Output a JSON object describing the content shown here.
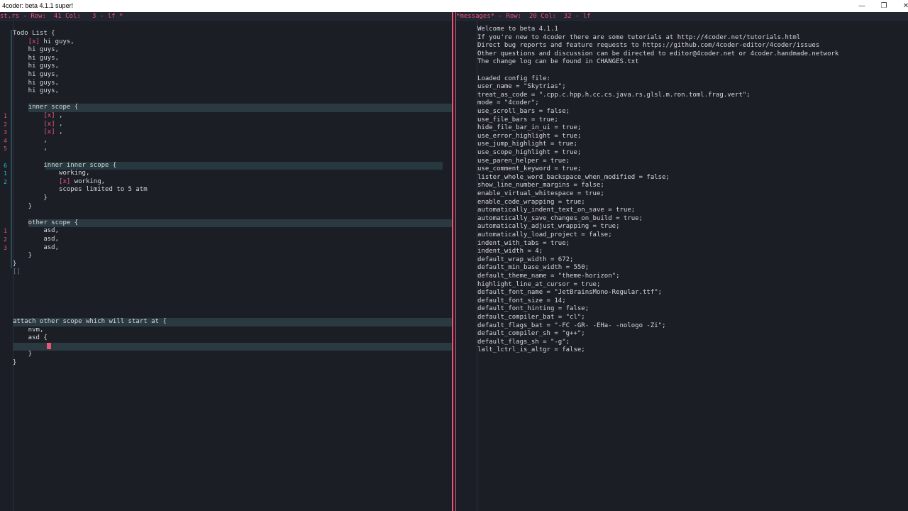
{
  "window": {
    "title": "4coder: beta 4.1.1 super!",
    "min": "—",
    "max": "❐",
    "close": "✕"
  },
  "left_pane": {
    "filebar": "st.rs - Row:  41 Col:   3 - lf *",
    "lines": [
      {
        "ln": "",
        "text": "Todo List {"
      },
      {
        "ln": "",
        "pre": "    ",
        "check": "[x]",
        "text": " hi guys,"
      },
      {
        "ln": "",
        "text": "    hi guys,"
      },
      {
        "ln": "",
        "text": "    hi guys,"
      },
      {
        "ln": "",
        "text": "    hi guys,"
      },
      {
        "ln": "",
        "text": "    hi guys,"
      },
      {
        "ln": "",
        "text": "    hi guys,"
      },
      {
        "ln": "",
        "text": "    hi guys,"
      },
      {
        "ln": "",
        "text": ""
      },
      {
        "ln": "",
        "text": "    inner scope {"
      },
      {
        "ln": "1",
        "pre": "        ",
        "check": "[x]",
        "text": " ,"
      },
      {
        "ln": "2",
        "pre": "        ",
        "check": "[x]",
        "text": " ,"
      },
      {
        "ln": "3",
        "pre": "        ",
        "check": "[x]",
        "text": " ,"
      },
      {
        "ln": "4",
        "text": "        ,"
      },
      {
        "ln": "5",
        "text": "        ,"
      },
      {
        "ln": "",
        "text": ""
      },
      {
        "ln": "6",
        "text": "        inner inner scope {"
      },
      {
        "ln": "1",
        "text": "            working,"
      },
      {
        "ln": "2",
        "pre": "            ",
        "check": "[x]",
        "text": " working,"
      },
      {
        "ln": "",
        "text": "            scopes limited to 5 atm"
      },
      {
        "ln": "",
        "text": "        }"
      },
      {
        "ln": "",
        "text": "    }"
      },
      {
        "ln": "",
        "text": ""
      },
      {
        "ln": "",
        "text": "    other scope {"
      },
      {
        "ln": "1",
        "text": "        asd,"
      },
      {
        "ln": "2",
        "text": "        asd,"
      },
      {
        "ln": "3",
        "text": "        asd,"
      },
      {
        "ln": "",
        "text": "    }"
      },
      {
        "ln": "",
        "text": "}"
      },
      {
        "ln": "",
        "text": "[]"
      },
      {
        "ln": "",
        "text": ""
      },
      {
        "ln": "",
        "text": ""
      },
      {
        "ln": "",
        "text": ""
      },
      {
        "ln": "",
        "text": ""
      },
      {
        "ln": "",
        "text": ""
      },
      {
        "ln": "",
        "text": "attach other scope which will start at {"
      },
      {
        "ln": "",
        "text": "    nvm,"
      },
      {
        "ln": "",
        "text": "    asd {"
      },
      {
        "ln": "",
        "text": ""
      },
      {
        "ln": "",
        "text": "    }"
      },
      {
        "ln": "",
        "text": "}"
      }
    ]
  },
  "right_pane": {
    "filebar": "*messages* - Row:  20 Col:  32 - lf",
    "lines": [
      "Welcome to beta 4.1.1",
      "If you're new to 4coder there are some tutorials at http://4coder.net/tutorials.html",
      "Direct bug reports and feature requests to https://github.com/4coder-editor/4coder/issues",
      "Other questions and discussion can be directed to editor@4coder.net or 4coder.handmade.network",
      "The change log can be found in CHANGES.txt",
      "",
      "Loaded config file:",
      "user_name = \"Skytrias\";",
      "treat_as_code = \".cpp.c.hpp.h.cc.cs.java.rs.glsl.m.ron.toml.frag.vert\";",
      "mode = \"4coder\";",
      "use_scroll_bars = false;",
      "use_file_bars = true;",
      "hide_file_bar_in_ui = true;",
      "use_error_highlight = true;",
      "use_jump_highlight = true;",
      "use_scope_highlight = true;",
      "use_paren_helper = true;",
      "use_comment_keyword = true;",
      "lister_whole_word_backspace_when_modified = false;",
      "show_line_number_margins = false;",
      "enable_virtual_whitespace = true;",
      "enable_code_wrapping = true;",
      "automatically_indent_text_on_save = true;",
      "automatically_save_changes_on_build = true;",
      "automatically_adjust_wrapping = true;",
      "automatically_load_project = false;",
      "indent_with_tabs = true;",
      "indent_width = 4;",
      "default_wrap_width = 672;",
      "default_min_base_width = 550;",
      "default_theme_name = \"theme-horizon\";",
      "highlight_line_at_cursor = true;",
      "default_font_name = \"JetBrainsMono-Regular.ttf\";",
      "default_font_size = 14;",
      "default_font_hinting = false;",
      "default_compiler_bat = \"cl\";",
      "default_flags_bat = \"-FC -GR- -EHa- -nologo -Zi\";",
      "default_compiler_sh = \"g++\";",
      "default_flags_sh = \"-g\";",
      "lalt_lctrl_is_altgr = false;"
    ]
  },
  "colors": {
    "background": "#1c1e26",
    "accent": "#e95678",
    "text": "#d5d8da",
    "scope_highlight": "#2b3a41",
    "line_number_cyan": "#26bbd9"
  }
}
